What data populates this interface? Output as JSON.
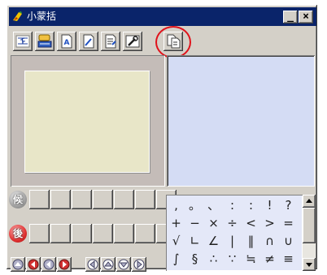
{
  "window": {
    "title": "小蒙括",
    "minimize_label": "_",
    "close_label": "×"
  },
  "toolbar": {
    "tools": [
      {
        "name": "translit",
        "icon": "mongolian-text-icon"
      },
      {
        "name": "keyboard",
        "icon": "keyboard-icon"
      },
      {
        "name": "doc-a",
        "icon": "document-a-icon"
      },
      {
        "name": "doc-pen",
        "icon": "document-pen-icon"
      },
      {
        "name": "doc-list",
        "icon": "document-list-icon"
      },
      {
        "name": "tool-wrench",
        "icon": "wrench-icon"
      },
      {
        "name": "doc-copy",
        "icon": "document-copy-icon"
      }
    ],
    "highlight_color": "#e0121b"
  },
  "panels": {
    "left_bg": "#c4bcb8",
    "left_inner_bg": "#e8e6c8",
    "right_bg": "#d4dcf4"
  },
  "candidates": {
    "row1_label": "候",
    "row2_label": "後"
  },
  "symbols": {
    "rows": [
      [
        ",",
        "。",
        "、",
        ":",
        ":",
        "!",
        "?"
      ],
      [
        "+",
        "−",
        "×",
        "÷",
        "<",
        ">",
        "="
      ],
      [
        "√",
        "∟",
        "∠",
        "|",
        "‖",
        "∩",
        "∪"
      ],
      [
        "∫",
        "§",
        "∴",
        "∵",
        "≒",
        "≠",
        "≡"
      ]
    ]
  },
  "scrollbar": {
    "up_label": "▲",
    "down_label": "▼"
  }
}
